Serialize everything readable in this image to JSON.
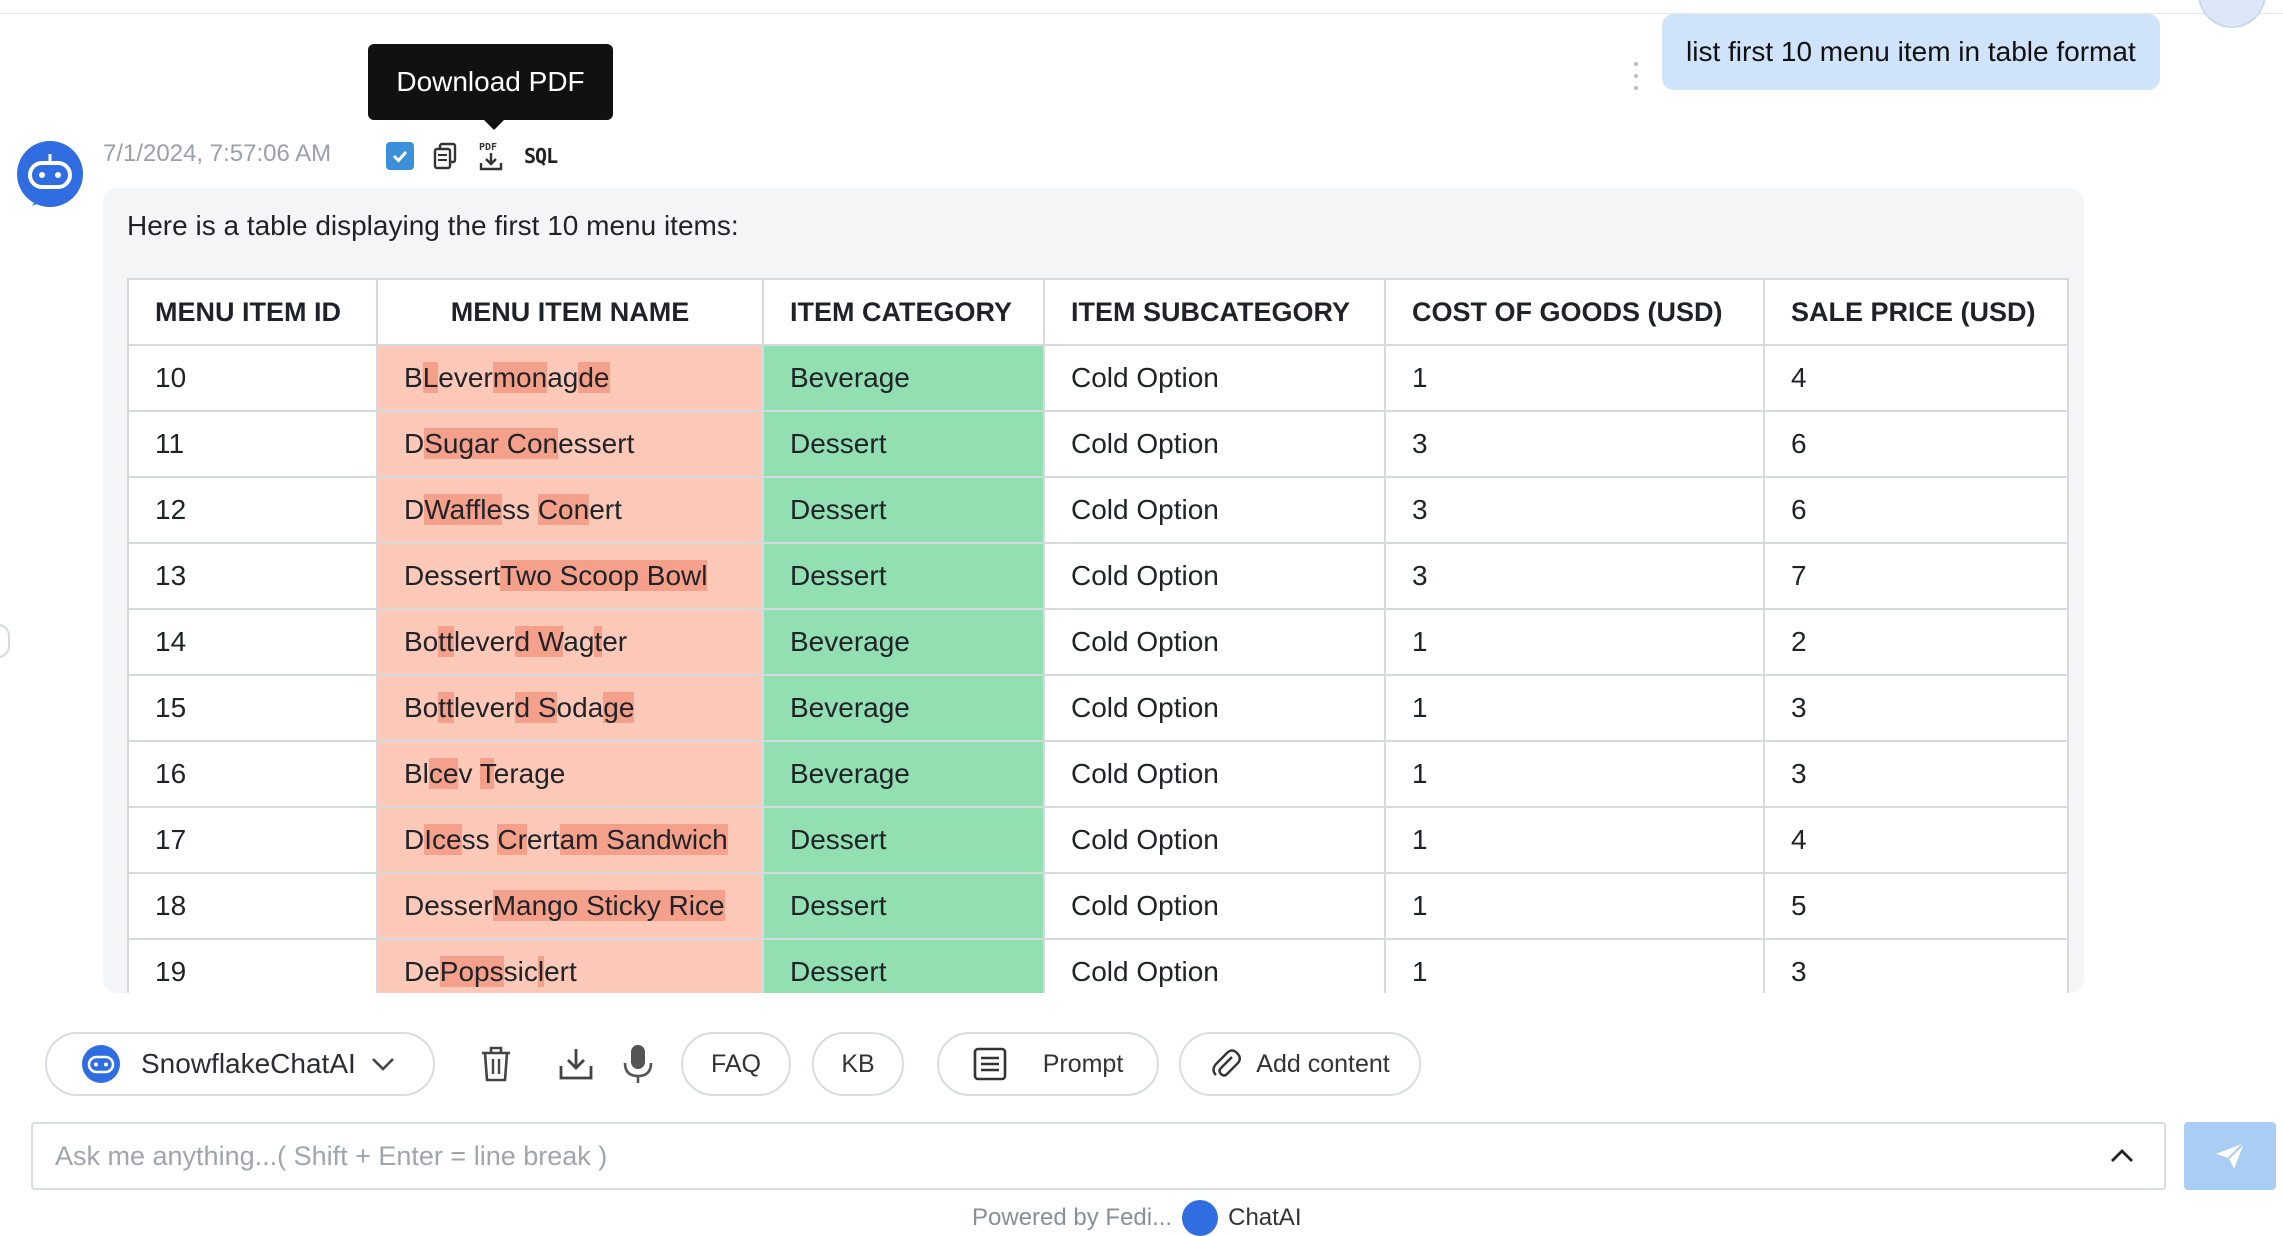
{
  "user_message": {
    "text": "list first 10 menu item in table format"
  },
  "tooltip": {
    "text": "Download PDF"
  },
  "bot_message": {
    "timestamp": "7/1/2024, 7:57:06 AM",
    "sql_label": "SQL",
    "pdf_label": "PDF",
    "intro": "Here is a table displaying the first 10 menu items:"
  },
  "table": {
    "headers": [
      "MENU ITEM ID",
      "MENU ITEM NAME",
      "ITEM CATEGORY",
      "ITEM SUBCATEGORY",
      "COST OF GOODS (USD)",
      "SALE PRICE (USD)"
    ],
    "rows": [
      {
        "id": "10",
        "name_parts": [
          "B",
          "L",
          "ever",
          "mon",
          "ag",
          "de"
        ],
        "category": "Beverage",
        "subcategory": "Cold Option",
        "cost": "1",
        "price": "4"
      },
      {
        "id": "11",
        "name_parts": [
          "D",
          "Sugar Con",
          "essert"
        ],
        "category": "Dessert",
        "subcategory": "Cold Option",
        "cost": "3",
        "price": "6"
      },
      {
        "id": "12",
        "name_parts": [
          "D",
          "Waffle",
          "ss ",
          "Con",
          "ert"
        ],
        "category": "Dessert",
        "subcategory": "Cold Option",
        "cost": "3",
        "price": "6"
      },
      {
        "id": "13",
        "name_parts": [
          "Dessert",
          "Two Scoop Bowl"
        ],
        "category": "Dessert",
        "subcategory": "Cold Option",
        "cost": "3",
        "price": "7"
      },
      {
        "id": "14",
        "name_parts": [
          "Bo",
          "tt",
          "lever",
          "d W",
          "ag",
          "t",
          "er",
          ""
        ],
        "category": "Beverage",
        "subcategory": "Cold Option",
        "cost": "1",
        "price": "2"
      },
      {
        "id": "15",
        "name_parts": [
          "Bo",
          "tt",
          "lever",
          "d S",
          "oda",
          "ge"
        ],
        "category": "Beverage",
        "subcategory": "Cold Option",
        "cost": "1",
        "price": "3"
      },
      {
        "id": "16",
        "name_parts": [
          "Bl",
          "ce",
          "v ",
          "T",
          "erage"
        ],
        "category": "Beverage",
        "subcategory": "Cold Option",
        "cost": "1",
        "price": "3"
      },
      {
        "id": "17",
        "name_parts": [
          "D",
          "Ice",
          "ss ",
          "Cr",
          "ert",
          "am Sandwich"
        ],
        "category": "Dessert",
        "subcategory": "Cold Option",
        "cost": "1",
        "price": "4"
      },
      {
        "id": "18",
        "name_parts": [
          "Desser",
          "Mango Sticky Rice"
        ],
        "category": "Dessert",
        "subcategory": "Cold Option",
        "cost": "1",
        "price": "5"
      },
      {
        "id": "19",
        "name_parts": [
          "De",
          "Pops",
          "sic",
          "l",
          "ert"
        ],
        "category": "Dessert",
        "subcategory": "Cold Option",
        "cost": "1",
        "price": "3"
      }
    ]
  },
  "toolbar": {
    "model_name": "SnowflakeChatAI",
    "faq_label": "FAQ",
    "kb_label": "KB",
    "prompt_label": "Prompt",
    "add_content_label": "Add content"
  },
  "composer": {
    "placeholder": "Ask me anything...( Shift + Enter = line break )"
  },
  "footer": {
    "prefix": "Powered by Fedi...",
    "brand": "ChatAI"
  },
  "colors": {
    "accent": "#3b8fdb",
    "name_cell": "#fcc8b8",
    "name_highlight": "#f4a08b",
    "category_cell": "#92dfb2",
    "user_bubble": "#cfe3fb",
    "send_button": "#a9cdf3"
  }
}
